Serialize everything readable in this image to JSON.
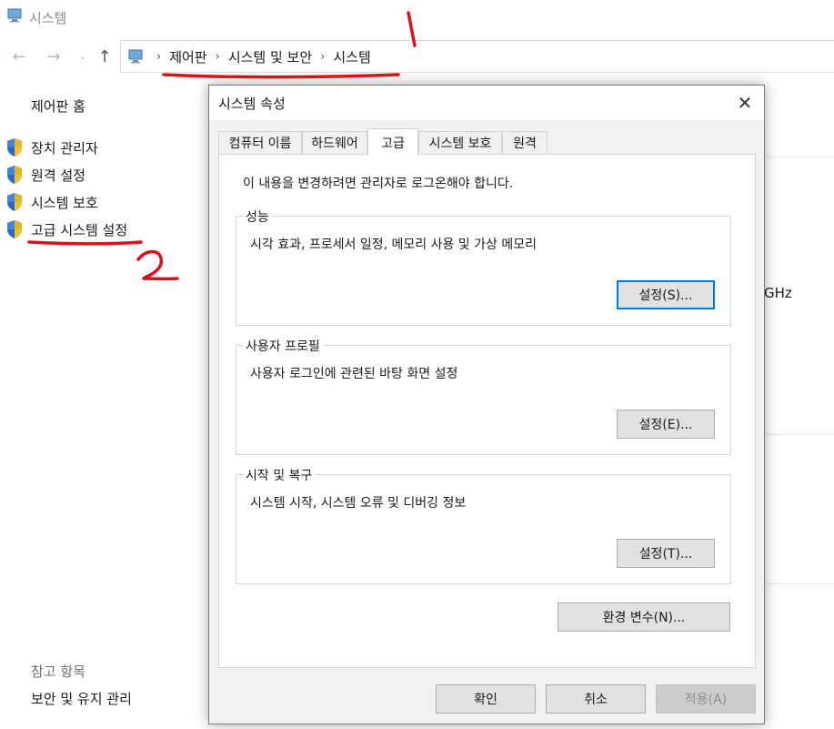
{
  "window": {
    "title": "시스템"
  },
  "address": {
    "crumbs": [
      "제어판",
      "시스템 및 보안",
      "시스템"
    ]
  },
  "sidebar": {
    "home": "제어판 홈",
    "items": [
      "장치 관리자",
      "원격 설정",
      "시스템 보호",
      "고급 시스템 설정"
    ],
    "see_also": "참고 항목",
    "security": "보안 및 유지 관리"
  },
  "background": {
    "ghz_fragment": "GHz"
  },
  "dialog": {
    "title": "시스템 속성",
    "tabs": [
      "컴퓨터 이름",
      "하드웨어",
      "고급",
      "시스템 보호",
      "원격"
    ],
    "active_tab": "고급",
    "admin_note": "이 내용을 변경하려면 관리자로 로그온해야 합니다.",
    "performance": {
      "label": "성능",
      "desc": "시각 효과, 프로세서 일정, 메모리 사용 및 가상 메모리",
      "button": "설정(S)..."
    },
    "user_profiles": {
      "label": "사용자 프로필",
      "desc": "사용자 로그인에 관련된 바탕 화면 설정",
      "button": "설정(E)..."
    },
    "startup": {
      "label": "시작 및 복구",
      "desc": "시스템 시작, 시스템 오류 및 디버깅 정보",
      "button": "설정(T)..."
    },
    "env_button": "환경 변수(N)...",
    "ok": "확인",
    "cancel": "취소",
    "apply": "적용(A)"
  },
  "annotations": {
    "marker_color": "#e0101a"
  },
  "icons": [
    "computer-icon",
    "back-arrow-icon",
    "forward-arrow-icon",
    "recent-dropdown-icon",
    "up-arrow-icon",
    "uac-shield-icon",
    "close-icon"
  ],
  "colors": {
    "accent": "#0078d7",
    "dialog_bg": "#f0f0f0",
    "button_bg": "#e1e1e1"
  }
}
